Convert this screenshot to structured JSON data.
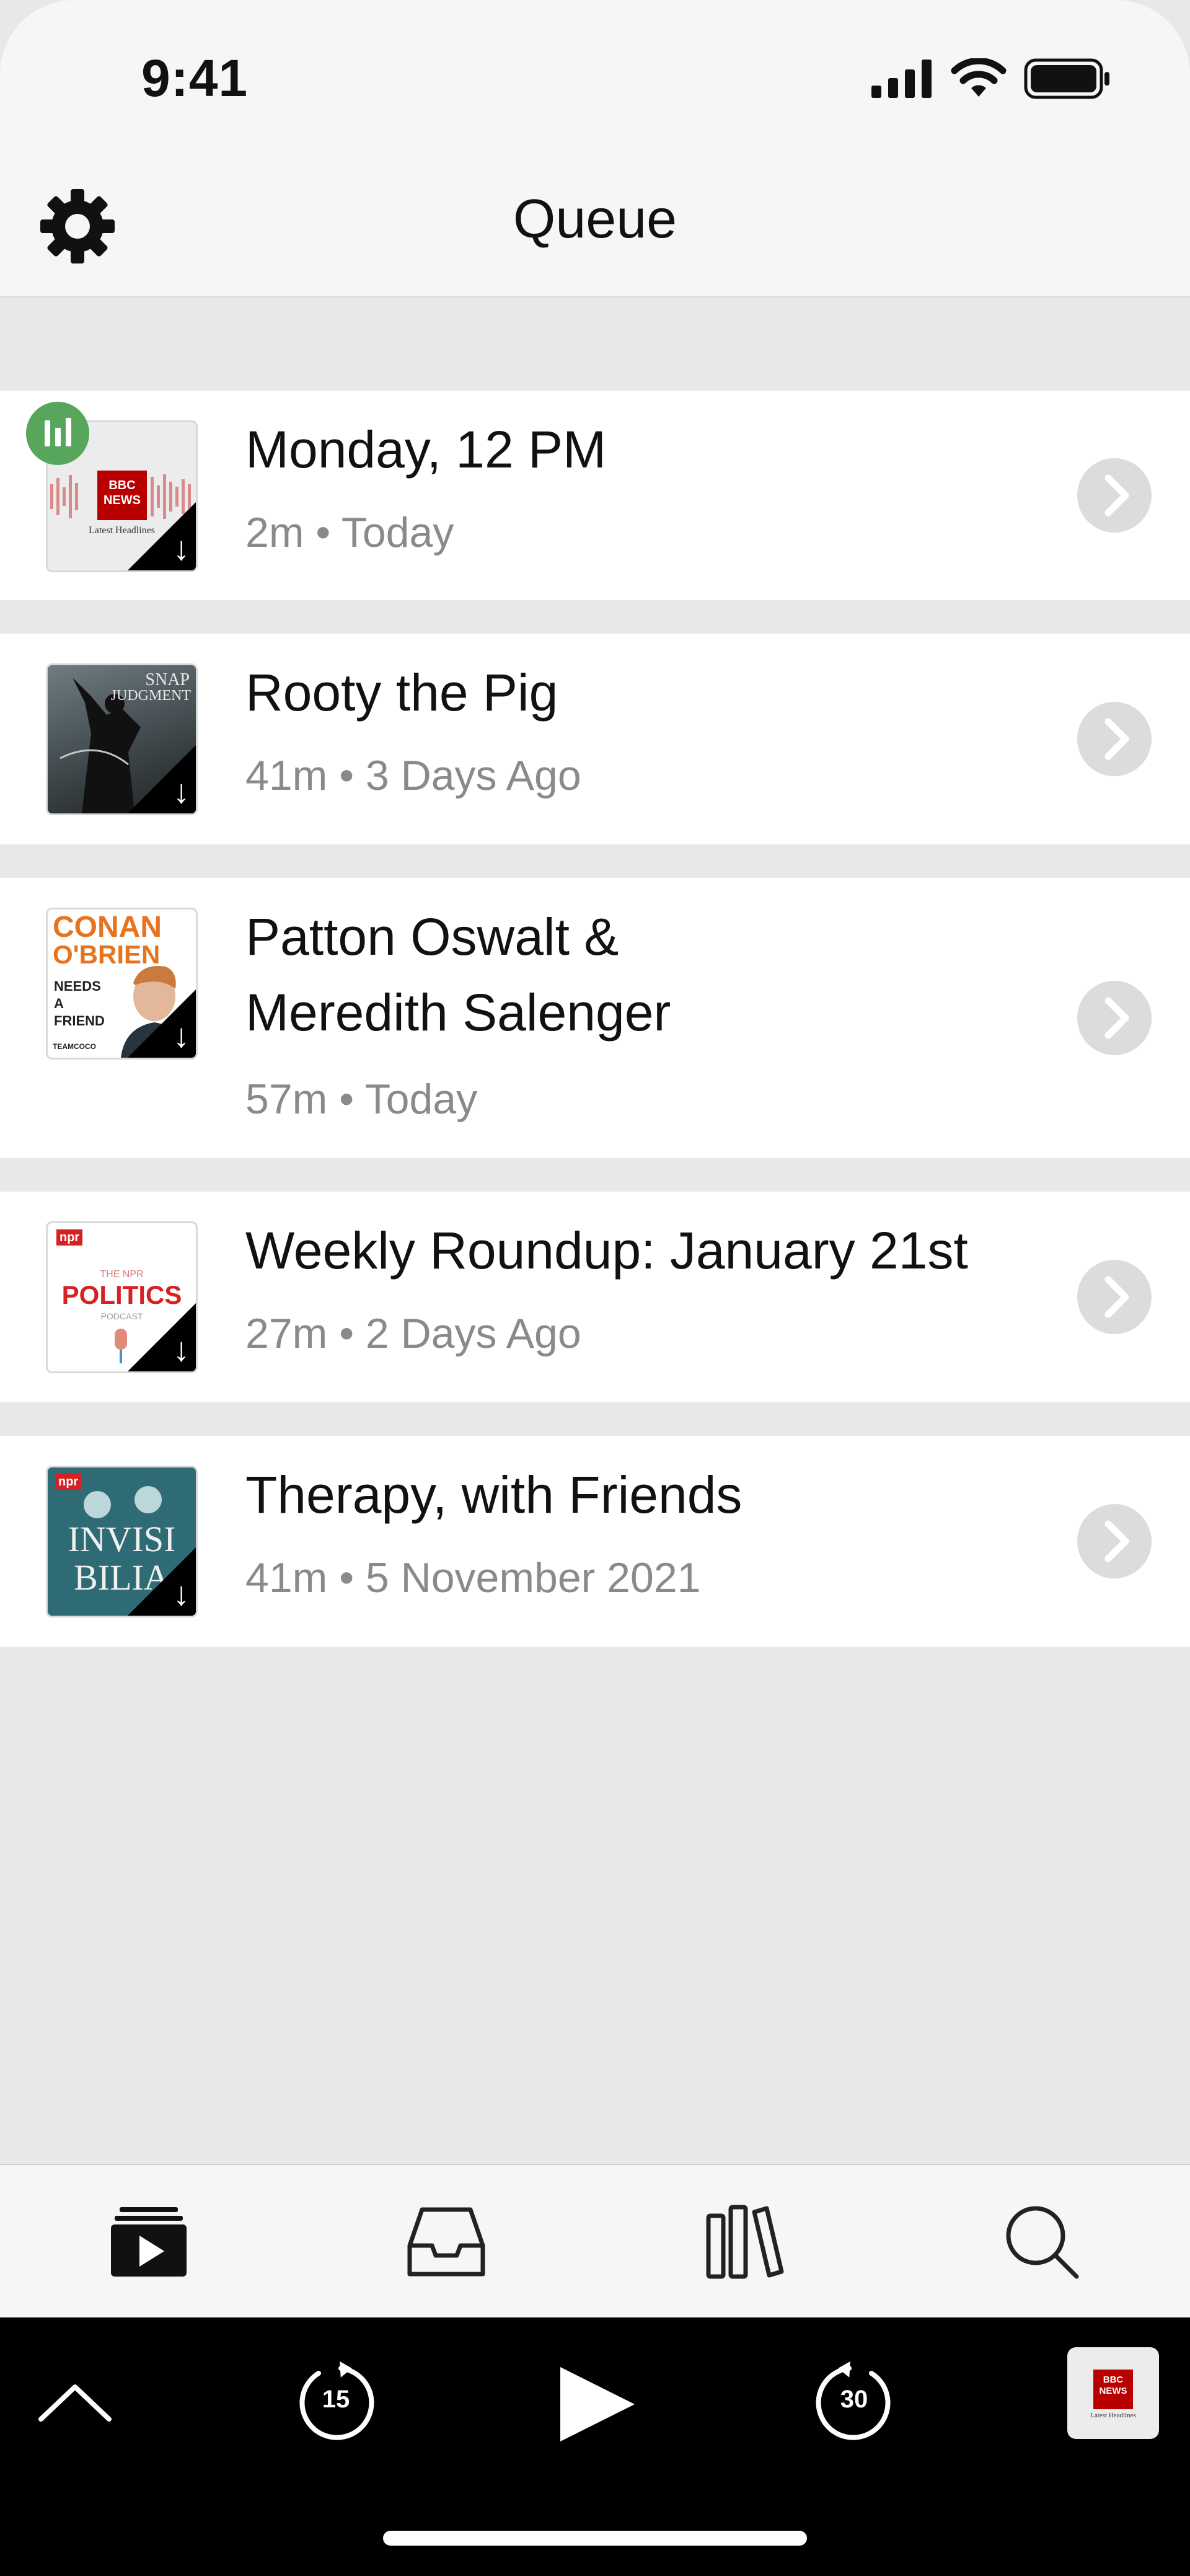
{
  "status": {
    "time": "9:41"
  },
  "header": {
    "title": "Queue"
  },
  "episodes": [
    {
      "title": "Monday, 12 PM",
      "duration": "2m",
      "date": "Today",
      "art_top": "BBC",
      "art_mid": "NEWS",
      "art_bottom": "Latest Headlines",
      "downloaded": true,
      "playing": true
    },
    {
      "title": "Rooty the Pig",
      "duration": "41m",
      "date": "3 Days Ago",
      "art_top": "SNAP",
      "art_mid": "JUDGMENT",
      "downloaded": true,
      "playing": false
    },
    {
      "title_line1": "Patton Oswalt &",
      "title_line2": "Meredith Salenger",
      "duration": "57m",
      "date": "Today",
      "art_top": "CONAN",
      "art_mid": "O'BRIEN",
      "art_bottom": "NEEDS A FRIEND",
      "art_tag": "TEAMCOCO",
      "downloaded": true,
      "playing": false
    },
    {
      "title": "Weekly Roundup: January 21st",
      "duration": "27m",
      "date": "2 Days Ago",
      "art_top": "npr",
      "art_small": "THE NPR",
      "art_mid": "POLITICS",
      "art_bottom": "PODCAST",
      "downloaded": true,
      "playing": false
    },
    {
      "title": "Therapy, with Friends",
      "duration": "41m",
      "date": "5 November 2021",
      "art_top": "npr",
      "art_mid": "INVISI",
      "art_bottom": "BILIA",
      "downloaded": true,
      "playing": false
    }
  ],
  "separator": "•",
  "tabs": [
    {
      "name": "queue",
      "icon": "play-stack-icon",
      "active": true
    },
    {
      "name": "inbox",
      "icon": "inbox-tray-icon",
      "active": false
    },
    {
      "name": "library",
      "icon": "library-books-icon",
      "active": false
    },
    {
      "name": "search",
      "icon": "search-icon",
      "active": false
    }
  ],
  "player": {
    "skip_back": "15",
    "skip_forward": "30",
    "now_playing_art": {
      "top": "BBC",
      "mid": "NEWS",
      "bottom": "Latest Headlines"
    }
  },
  "colors": {
    "accent_green": "#58a65c",
    "bbc_red": "#b80000",
    "conan_orange": "#e8731f",
    "npr_red": "#d62021",
    "invisibilia_teal": "#2e6b75"
  }
}
